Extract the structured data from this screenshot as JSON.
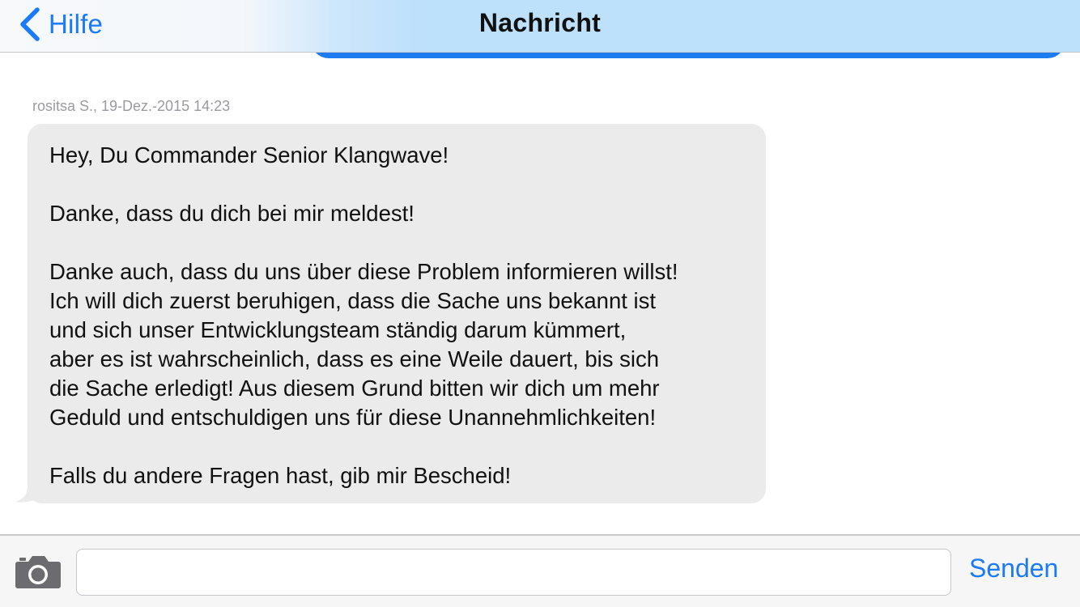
{
  "navbar": {
    "back_label": "Hilfe",
    "title": "Nachricht"
  },
  "message": {
    "meta": "rositsa S., 19-Dez.-2015 14:23",
    "lines": [
      "Hey, Du Commander Senior Klangwave!",
      "",
      "Danke, dass du dich bei mir meldest!",
      "",
      "Danke auch, dass du uns über diese Problem informieren willst!",
      "Ich will dich zuerst beruhigen, dass die Sache uns bekannt ist",
      "und sich unser Entwicklungsteam ständig darum kümmert,",
      "aber es ist wahrscheinlich, dass es eine Weile dauert, bis sich",
      "die Sache erledigt! Aus diesem Grund bitten wir dich um mehr",
      "Geduld und entschuldigen uns für diese Unannehmlichkeiten!",
      "",
      "Falls du andere Fragen hast, gib mir Bescheid!"
    ]
  },
  "composer": {
    "input_value": "",
    "input_placeholder": "",
    "send_label": "Senden",
    "camera_icon": "camera-icon"
  },
  "colors": {
    "accent": "#1a7af7",
    "outgoing_bubble": "#1e7cf2",
    "incoming_bubble": "#ebebeb",
    "meta_text": "#9a9aa0"
  }
}
